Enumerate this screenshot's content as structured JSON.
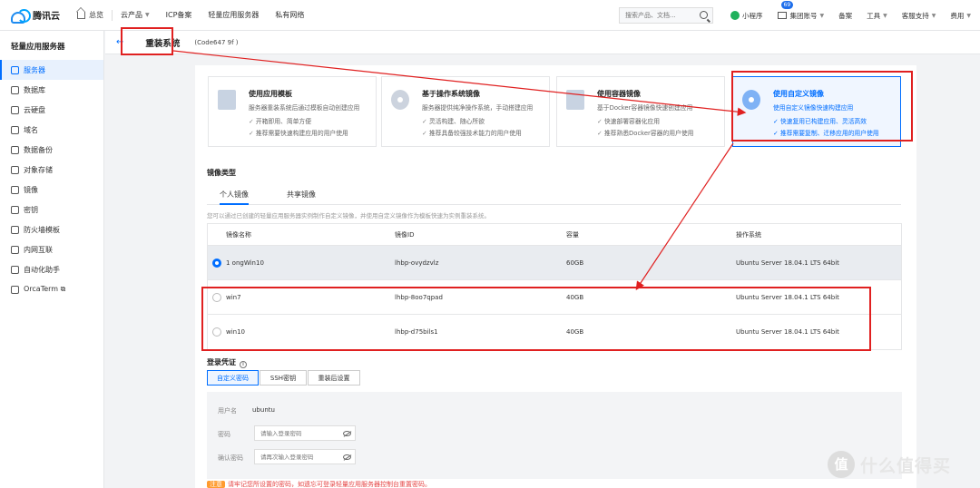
{
  "brand": {
    "name": "腾讯云"
  },
  "topnav": {
    "overview": "总览",
    "products": "云产品",
    "icp": "ICP备案",
    "lighthouse": "轻量应用服务器",
    "private_network": "私有网络",
    "search_placeholder": "搜索产品、文档...",
    "miniprogram": "小程序",
    "mail_badge": "69",
    "account": "集团账号",
    "beian": "备案",
    "tools": "工具",
    "support": "客服支持",
    "billing": "费用"
  },
  "sidebar": {
    "title": "轻量应用服务器",
    "items": [
      {
        "label": "服务器",
        "icon": "server-icon",
        "active": true
      },
      {
        "label": "数据库",
        "icon": "database-icon"
      },
      {
        "label": "云硬盘",
        "icon": "disk-icon"
      },
      {
        "label": "域名",
        "icon": "domain-icon"
      },
      {
        "label": "数据备份",
        "icon": "backup-icon"
      },
      {
        "label": "对象存储",
        "icon": "storage-icon"
      },
      {
        "label": "镜像",
        "icon": "image-icon"
      },
      {
        "label": "密钥",
        "icon": "key-icon"
      },
      {
        "label": "防火墙模板",
        "icon": "firewall-icon"
      },
      {
        "label": "内网互联",
        "icon": "network-icon"
      },
      {
        "label": "自动化助手",
        "icon": "automation-icon"
      },
      {
        "label": "OrcaTerm ⧉",
        "icon": "terminal-icon"
      }
    ]
  },
  "page": {
    "back": "←",
    "title": "重装系统",
    "instance_id": "(Code647                    9f )"
  },
  "options": [
    {
      "title": "使用应用模板",
      "sub": "服务器重装系统后通过模板自动创建应用",
      "b1": "开箱即用、简单方便",
      "b2": "推荐需要快速构建应用的用户使用"
    },
    {
      "title": "基于操作系统镜像",
      "sub": "服务器提供纯净操作系统，手动搭建应用",
      "b1": "灵活构建、随心所欲",
      "b2": "推荐具备较强技术能力的用户使用"
    },
    {
      "title": "使用容器镜像",
      "sub": "基于Docker容器镜像快速创建应用",
      "b1": "快速部署容器化应用",
      "b2": "推荐熟悉Docker容器的用户使用"
    },
    {
      "title": "使用自定义镜像",
      "sub": "使用自定义镜像快速构建应用",
      "b1": "快速复用已构建应用、灵活高效",
      "b2": "推荐需要复制、迁移应用的用户使用"
    }
  ],
  "image_type": {
    "label": "镜像类型",
    "tab_personal": "个人镜像",
    "tab_shared": "共享镜像",
    "hint": "您可以通过已创建的轻量应用服务器实例制作自定义镜像，并使用自定义镜像作为模板快速为实例重装系统。"
  },
  "table": {
    "headers": [
      "镜像名称",
      "镜像ID",
      "容量",
      "操作系统"
    ],
    "rows": [
      {
        "name": "1        ongWin10",
        "id": "lhbp-ovydzvlz",
        "size": "60GB",
        "os": "Ubuntu Server 18.04.1 LTS 64bit",
        "selected": true
      },
      {
        "name": "win7",
        "id": "lhbp-8oo7qpad",
        "size": "40GB",
        "os": "Ubuntu Server 18.04.1 LTS 64bit",
        "selected": false
      },
      {
        "name": "win10",
        "id": "lhbp-d75bils1",
        "size": "40GB",
        "os": "Ubuntu Server 18.04.1 LTS 64bit",
        "selected": false
      }
    ]
  },
  "credentials": {
    "label": "登录凭证",
    "info": "i",
    "seg_custom": "自定义密码",
    "seg_ssh": "SSH密钥",
    "seg_after": "重装后设置",
    "username_label": "用户名",
    "username_value": "ubuntu",
    "password_label": "密码",
    "password_placeholder": "请输入登录密码",
    "confirm_label": "确认密码",
    "confirm_placeholder": "请再次输入登录密码"
  },
  "notice": {
    "tag": "注意",
    "text": "请牢记您所设置的密码，如遗忘可登录轻量应用服务器控制台重置密码。"
  },
  "watermark": {
    "badge": "值",
    "text": "什么值得买"
  },
  "colors": {
    "accent": "#006eff",
    "annotation": "#e02020"
  }
}
